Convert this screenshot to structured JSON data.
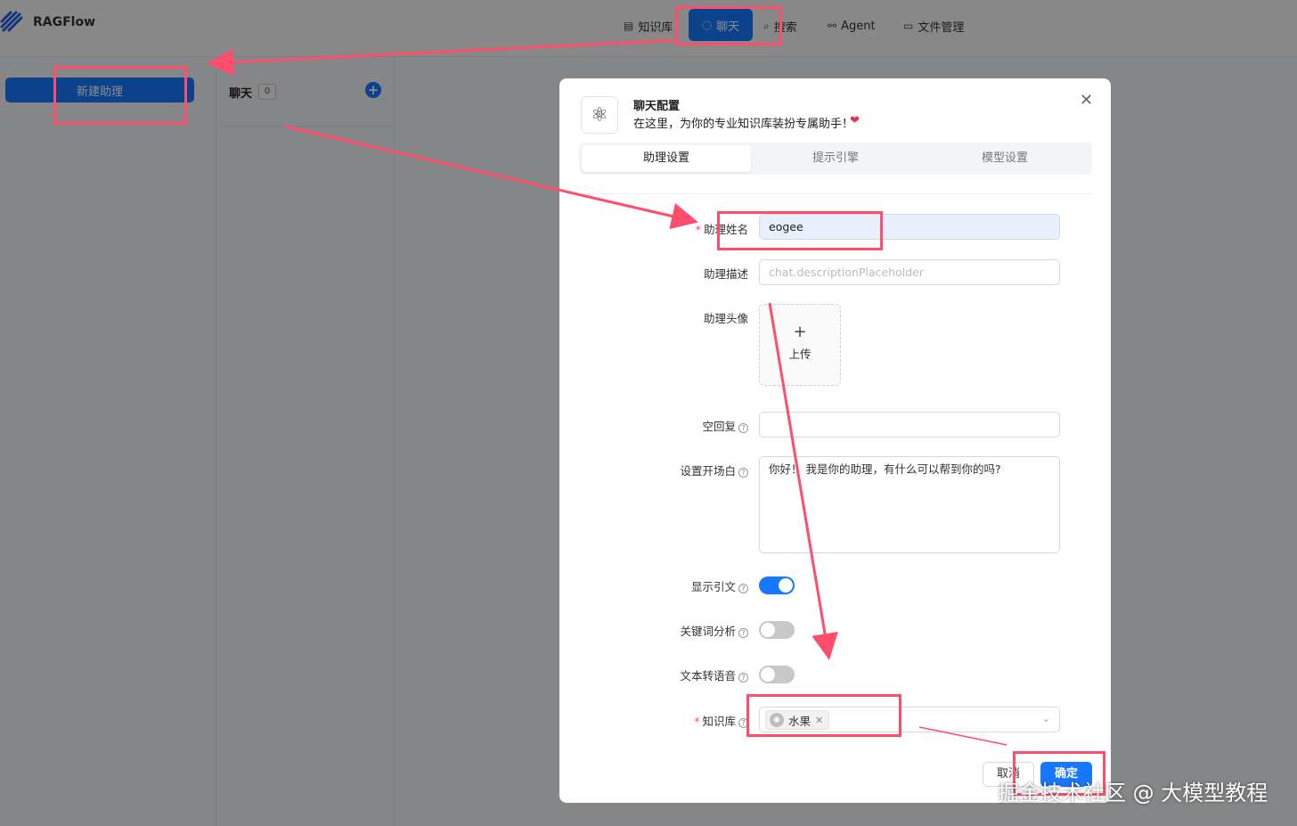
{
  "app": {
    "brand": "RAGFlow"
  },
  "nav": {
    "knowledge": "知识库",
    "chat": "聊天",
    "search": "搜索",
    "agent": "Agent",
    "files": "文件管理"
  },
  "left": {
    "new_assistant": "新建助理",
    "panel_title": "聊天",
    "count": "0"
  },
  "modal": {
    "title": "聊天配置",
    "subtitle": "在这里，为你的专业知识库装扮专属助手！",
    "tabs": [
      "助理设置",
      "提示引擎",
      "模型设置"
    ],
    "fields": {
      "name_label": "助理姓名",
      "name_value": "eogee",
      "desc_label": "助理描述",
      "desc_placeholder": "chat.descriptionPlaceholder",
      "avatar_label": "助理头像",
      "upload_label": "上传",
      "empty_label": "空回复",
      "opener_label": "设置开场白",
      "opener_value": "你好！ 我是你的助理，有什么可以帮到你的吗?",
      "quote_label": "显示引文",
      "quote_on": true,
      "keyword_label": "关键词分析",
      "keyword_on": false,
      "tts_label": "文本转语音",
      "tts_on": false,
      "kb_label": "知识库",
      "kb_tag": "水果"
    },
    "cancel": "取消",
    "ok": "确定"
  },
  "colors": {
    "accent": "#1677ff",
    "annotation": "#ff4d6d"
  },
  "watermark": "掘金技术社区 @ 大模型教程"
}
